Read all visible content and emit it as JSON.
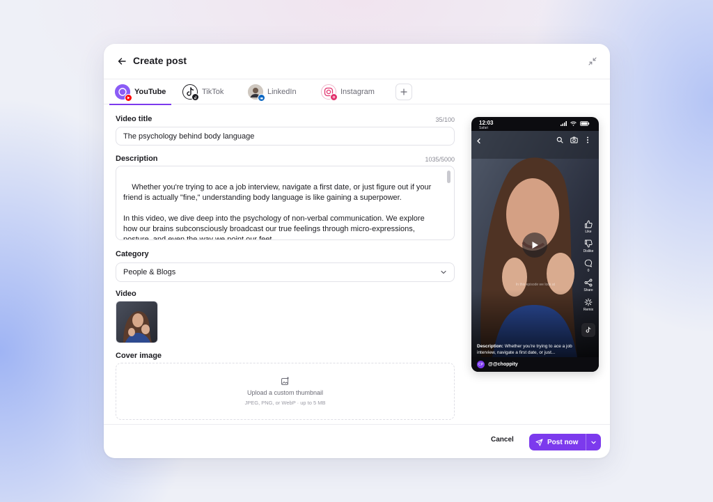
{
  "header": {
    "title": "Create post"
  },
  "tabs": [
    {
      "label": "YouTube",
      "active": true
    },
    {
      "label": "TikTok",
      "active": false
    },
    {
      "label": "LinkedIn",
      "active": false
    },
    {
      "label": "Instagram",
      "active": false
    }
  ],
  "form": {
    "video_title": {
      "label": "Video title",
      "counter": "35/100",
      "value": "The psychology behind body language"
    },
    "description": {
      "label": "Description",
      "counter": "1035/5000",
      "value": "Whether you're trying to ace a job interview, navigate a first date, or just figure out if your friend is actually \"fine,\" understanding body language is like gaining a superpower.\n\nIn this video, we dive deep into the psychology of non-verbal communication. We explore how our brains subconsciously broadcast our true feelings through micro-expressions, posture, and even the way we point our feet."
    },
    "category": {
      "label": "Category",
      "value": "People & Blogs"
    },
    "video": {
      "label": "Video"
    },
    "cover": {
      "label": "Cover image",
      "upload_title": "Upload a custom thumbnail",
      "upload_hint": "JPEG, PNG, or WebP · up to 5 MB"
    }
  },
  "preview": {
    "time": "12:03",
    "carrier": "Safari",
    "subtitle": "In this episode we look at",
    "actions": [
      {
        "label": "Like"
      },
      {
        "label": "Dislike"
      },
      {
        "label": "0"
      },
      {
        "label": "Share"
      },
      {
        "label": "Remix"
      }
    ],
    "description_prefix": "Description:",
    "description_text": "Whether you're trying to ace a job interview, navigate a first date, or just...",
    "handle": "@@choppity",
    "avatar_initials": "CP"
  },
  "footer": {
    "cancel_label": "Cancel",
    "post_label": "Post now"
  },
  "colors": {
    "accent": "#7c3aed",
    "youtube": "#ff0000",
    "instagram": "#e1306c",
    "linkedin": "#0a66c2"
  }
}
